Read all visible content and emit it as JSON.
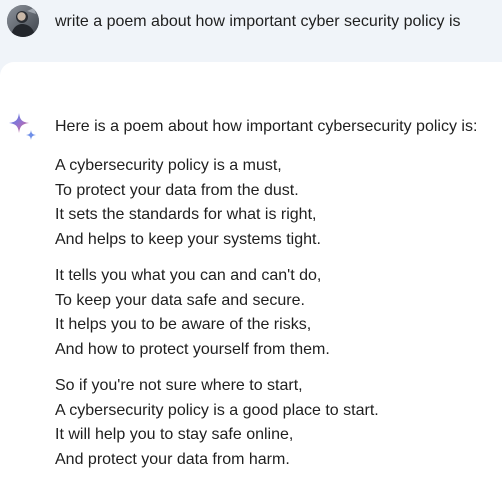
{
  "prompt": {
    "text": "write a poem about how important cyber security policy is"
  },
  "response": {
    "intro": "Here is a poem about how important cybersecurity policy is:",
    "stanzas": [
      [
        "A cybersecurity policy is a must,",
        "To protect your data from the dust.",
        "It sets the standards for what is right,",
        "And helps to keep your systems tight."
      ],
      [
        "It tells you what you can and can't do,",
        "To keep your data safe and secure.",
        "It helps you to be aware of the risks,",
        "And how to protect yourself from them."
      ],
      [
        "So if you're not sure where to start,",
        "A cybersecurity policy is a good place to start.",
        "It will help you to stay safe online,",
        "And protect your data from harm."
      ]
    ]
  },
  "icons": {
    "avatar": "user-avatar-photo",
    "assistant": "sparkle-icon"
  },
  "colors": {
    "prompt_background": "#f0f4f9",
    "response_background": "#ffffff",
    "text": "#1f1f1f",
    "sparkle_blue": "#4285f4",
    "sparkle_purple": "#9b72cb",
    "sparkle_red": "#d96570"
  }
}
